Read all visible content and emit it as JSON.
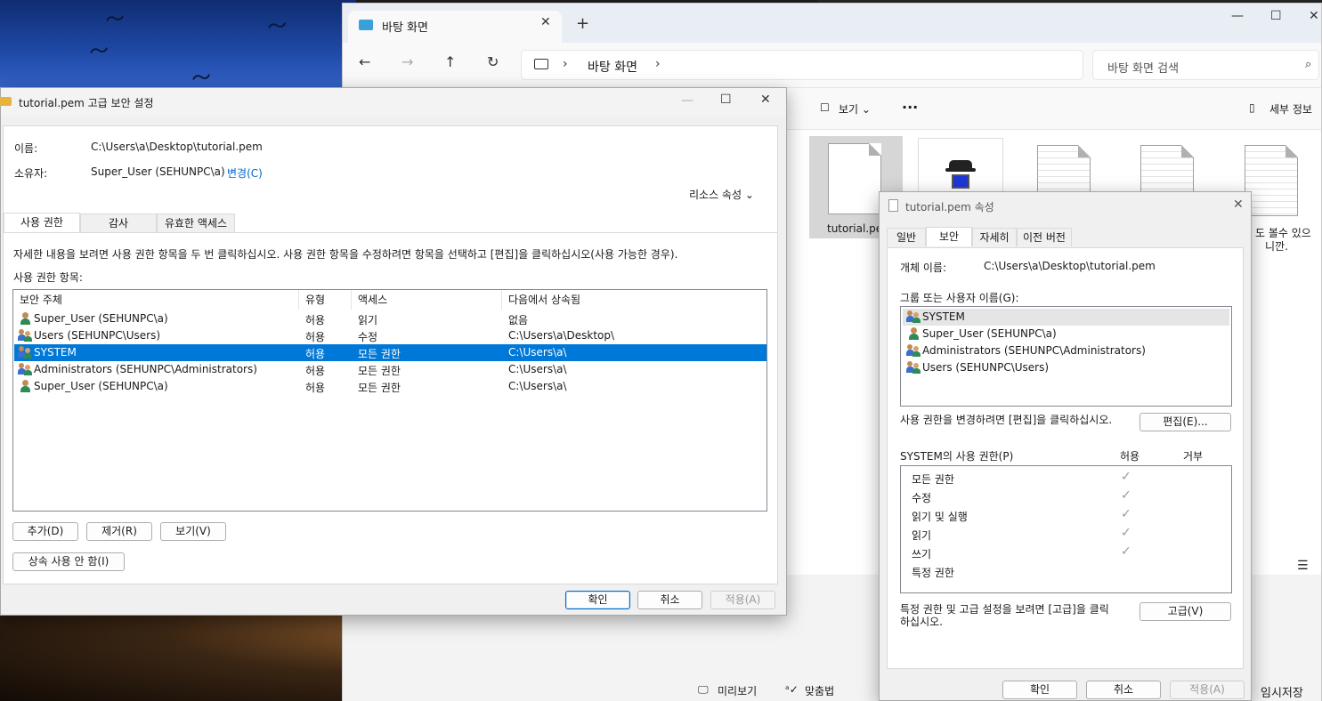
{
  "explorer": {
    "tab_title": "바탕 화면",
    "tab_close": "✕",
    "new_tab": "+",
    "nav": {
      "back": "←",
      "forward": "→",
      "up": "↑",
      "refresh": "↻"
    },
    "breadcrumb": "바탕 화면",
    "search_placeholder": "바탕 화면 검색",
    "window_controls": {
      "minimize": "—",
      "maximize": "☐",
      "close": "✕"
    },
    "cmd_view": "보기",
    "cmd_more": "···",
    "cmd_details": "세부 정보",
    "file_selected_label": "tutorial.pem",
    "file_partial_label_1": "도 볼수 있으",
    "file_partial_label_2": "니깐.",
    "bottom_preview": "미리보기",
    "bottom_spell": "맞춤법",
    "bottom_save": "임시저장"
  },
  "advanced": {
    "title": "tutorial.pem 고급 보안 설정",
    "name_label": "이름:",
    "name_value": "C:\\Users\\a\\Desktop\\tutorial.pem",
    "owner_label": "소유자:",
    "owner_value": "Super_User (SEHUNPC\\a)",
    "owner_change": "변경(C)",
    "resource_props": "리소스 속성",
    "tabs": [
      "사용 권한",
      "감사",
      "유효한 액세스"
    ],
    "instruction": "자세한 내용을 보려면 사용 권한 항목을 두 번 클릭하십시오. 사용 권한 항목을 수정하려면 항목을 선택하고 [편집]을 클릭하십시오(사용 가능한 경우).",
    "entries_label": "사용 권한 항목:",
    "columns": [
      "보안 주체",
      "유형",
      "액세스",
      "다음에서 상속됨"
    ],
    "rows": [
      {
        "principal": "Super_User (SEHUNPC\\a)",
        "type": "허용",
        "access": "읽기",
        "inherited": "없음"
      },
      {
        "principal": "Users (SEHUNPC\\Users)",
        "type": "허용",
        "access": "수정",
        "inherited": "C:\\Users\\a\\Desktop\\"
      },
      {
        "principal": "SYSTEM",
        "type": "허용",
        "access": "모든 권한",
        "inherited": "C:\\Users\\a\\"
      },
      {
        "principal": "Administrators (SEHUNPC\\Administrators)",
        "type": "허용",
        "access": "모든 권한",
        "inherited": "C:\\Users\\a\\"
      },
      {
        "principal": "Super_User (SEHUNPC\\a)",
        "type": "허용",
        "access": "모든 권한",
        "inherited": "C:\\Users\\a\\"
      }
    ],
    "add": "추가(D)",
    "remove": "제거(R)",
    "view": "보기(V)",
    "disable_inheritance": "상속 사용 안 함(I)",
    "ok": "확인",
    "cancel": "취소",
    "apply": "적용(A)",
    "window_controls": {
      "minimize": "—",
      "maximize": "☐",
      "close": "✕"
    }
  },
  "properties": {
    "title": "tutorial.pem 속성",
    "close": "✕",
    "tabs": [
      "일반",
      "보안",
      "자세히",
      "이전 버전"
    ],
    "object_label": "개체 이름:",
    "object_value": "C:\\Users\\a\\Desktop\\tutorial.pem",
    "groups_label": "그룹 또는 사용자 이름(G):",
    "groups": [
      "SYSTEM",
      "Super_User (SEHUNPC\\a)",
      "Administrators (SEHUNPC\\Administrators)",
      "Users (SEHUNPC\\Users)"
    ],
    "change_hint": "사용 권한을 변경하려면 [편집]을 클릭하십시오.",
    "edit": "편집(E)...",
    "perm_header": "SYSTEM의 사용 권한(P)",
    "allow": "허용",
    "deny": "거부",
    "permissions": [
      "모든 권한",
      "수정",
      "읽기 및 실행",
      "읽기",
      "쓰기",
      "특정 권한"
    ],
    "check_mark": "✓",
    "advanced_hint_1": "특정 권한 및 고급 설정을 보려면 [고급]을 클릭",
    "advanced_hint_2": "하십시오.",
    "advanced": "고급(V)",
    "ok": "확인",
    "cancel": "취소",
    "apply": "적용(A)"
  }
}
